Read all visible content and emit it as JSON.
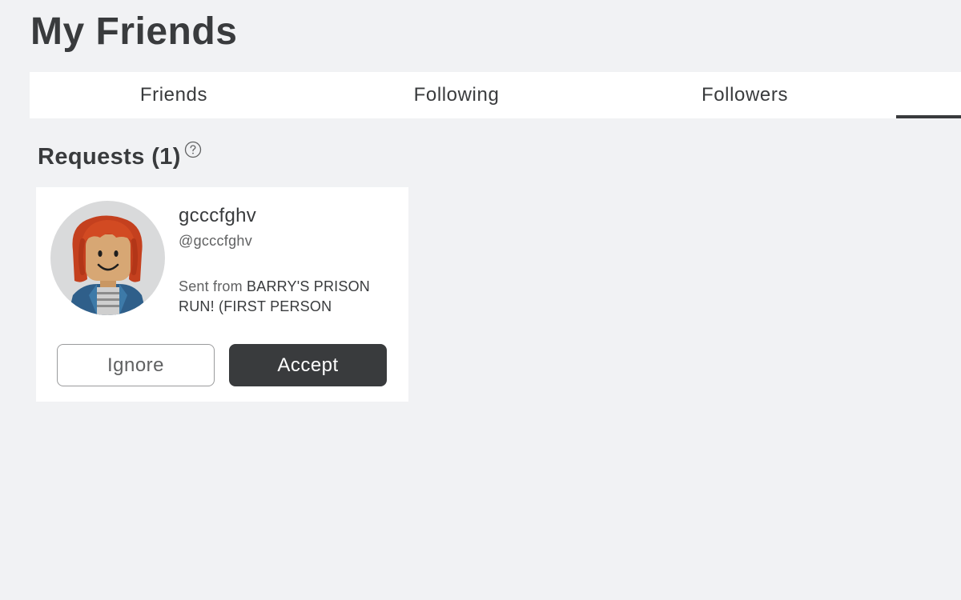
{
  "page": {
    "title": "My Friends"
  },
  "tabs": [
    {
      "label": "Friends"
    },
    {
      "label": "Following"
    },
    {
      "label": "Followers"
    },
    {
      "label": "",
      "active": true
    }
  ],
  "requests": {
    "heading": "Requests (1)",
    "help_icon": "question-circle-icon",
    "items": [
      {
        "display_name": "gcccfghv",
        "username": "@gcccfghv",
        "sent_prefix": "Sent from ",
        "sent_game": "BARRY'S PRISON RUN! (FIRST PERSON",
        "ignore_label": "Ignore",
        "accept_label": "Accept",
        "avatar_icon": "avatar-headshot"
      }
    ]
  },
  "colors": {
    "background": "#f1f2f4",
    "text_primary": "#393b3d",
    "text_secondary": "#606162",
    "accept_button": "#393b3d",
    "card": "#ffffff"
  }
}
